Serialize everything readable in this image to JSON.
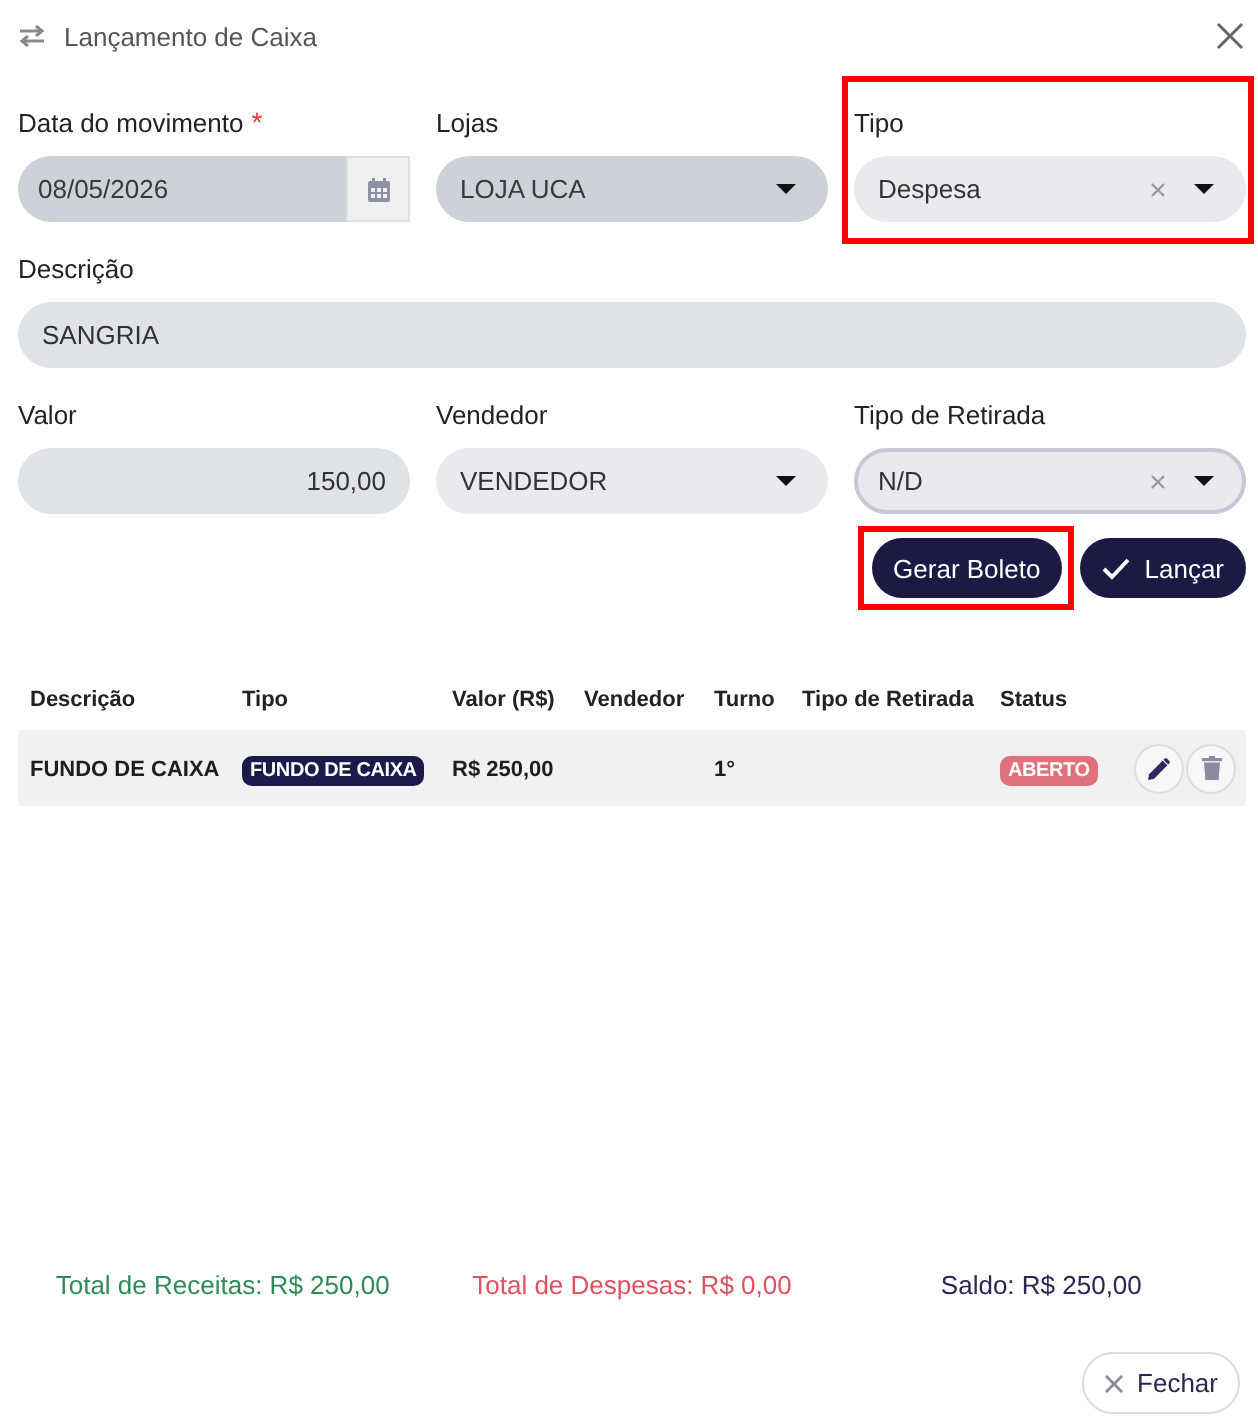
{
  "window": {
    "title": "Lançamento de Caixa"
  },
  "form": {
    "rows": [
      [
        {
          "kind": "date",
          "label": "Data do movimento",
          "required_mark": "*",
          "value": "08/05/2026",
          "disabled": true,
          "focused": false,
          "highlighted": false
        },
        {
          "kind": "select",
          "label": "Lojas",
          "value": "LOJA UCA",
          "disabled": true,
          "focused": false,
          "clearable": false,
          "highlighted": false
        },
        {
          "kind": "select",
          "label": "Tipo",
          "value": "Despesa",
          "disabled": false,
          "focused": false,
          "clearable": true,
          "highlighted": true
        }
      ],
      [
        {
          "kind": "text",
          "label": "Descrição",
          "value": "SANGRIA",
          "disabled": false,
          "focused": false,
          "highlighted": false
        }
      ],
      [
        {
          "kind": "number",
          "label": "Valor",
          "value": "150,00",
          "disabled": false,
          "focused": false,
          "highlighted": false
        },
        {
          "kind": "select",
          "label": "Vendedor",
          "value": "VENDEDOR",
          "disabled": false,
          "focused": false,
          "clearable": false,
          "highlighted": false
        },
        {
          "kind": "select",
          "label": "Tipo de Retirada",
          "value": "N/D",
          "disabled": false,
          "focused": true,
          "clearable": true,
          "highlighted": false
        }
      ]
    ],
    "actions": [
      {
        "kind": "plain",
        "label": "Gerar Boleto",
        "highlighted": true
      },
      {
        "kind": "confirm",
        "label": "Lançar",
        "highlighted": false
      }
    ]
  },
  "table": {
    "columns": [
      "Descrição",
      "Tipo",
      "Valor (R$)",
      "Vendedor",
      "Turno",
      "Tipo de Retirada",
      "Status"
    ],
    "rows": [
      {
        "cells": [
          {
            "kind": "text",
            "text": "FUNDO DE CAIXA"
          },
          {
            "kind": "badge",
            "text": "FUNDO DE CAIXA",
            "color": "#1b1a4a"
          },
          {
            "kind": "text",
            "text": "R$ 250,00"
          },
          {
            "kind": "empty"
          },
          {
            "kind": "text",
            "text": "1°"
          },
          {
            "kind": "empty"
          },
          {
            "kind": "badge",
            "text": "ABERTO",
            "color": "#e0707a"
          }
        ]
      }
    ]
  },
  "footer": {
    "totals": [
      {
        "text": "Total de Receitas: R$ 250,00",
        "color": "#2e8b57"
      },
      {
        "text": "Total de Despesas: R$ 0,00",
        "color": "#e0505f"
      },
      {
        "text": "Saldo: R$ 250,00",
        "color": "#2a2850"
      }
    ],
    "close_button": {
      "label": "Fechar"
    }
  }
}
